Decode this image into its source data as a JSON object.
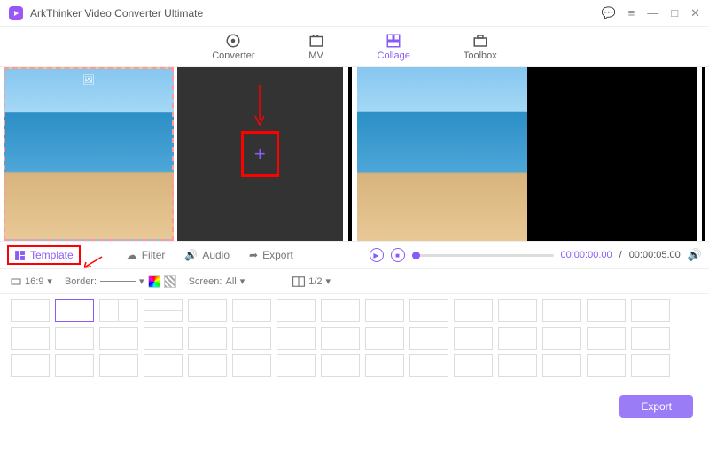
{
  "app": {
    "title": "ArkThinker Video Converter Ultimate"
  },
  "nav": {
    "converter": "Converter",
    "mv": "MV",
    "collage": "Collage",
    "toolbox": "Toolbox",
    "active": "collage"
  },
  "tabs": {
    "template": "Template",
    "filter": "Filter",
    "audio": "Audio",
    "export": "Export",
    "active": "template"
  },
  "playback": {
    "current": "00:00:00.00",
    "total": "00:00:05.00",
    "separator": "/"
  },
  "toolbar": {
    "aspect": "16:9",
    "border_label": "Border:",
    "screen_label": "Screen:",
    "screen_value": "All",
    "split_value": "1/2"
  },
  "buttons": {
    "export": "Export"
  },
  "colors": {
    "accent": "#8a5cf6",
    "highlight": "#ff0000"
  }
}
